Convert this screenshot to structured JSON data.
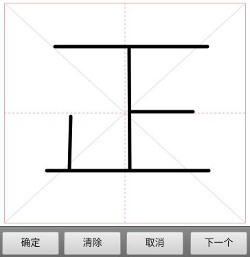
{
  "toolbar": {
    "confirm_label": "确定",
    "clear_label": "清除",
    "cancel_label": "取消",
    "next_label": "下一个"
  },
  "colors": {
    "guide_border": "#e9a3a3",
    "guide_lines": "#dddddd",
    "ink": "#000000",
    "toolbar_bg": "#7b7b7b",
    "button_bg": "#e2e2e2"
  }
}
